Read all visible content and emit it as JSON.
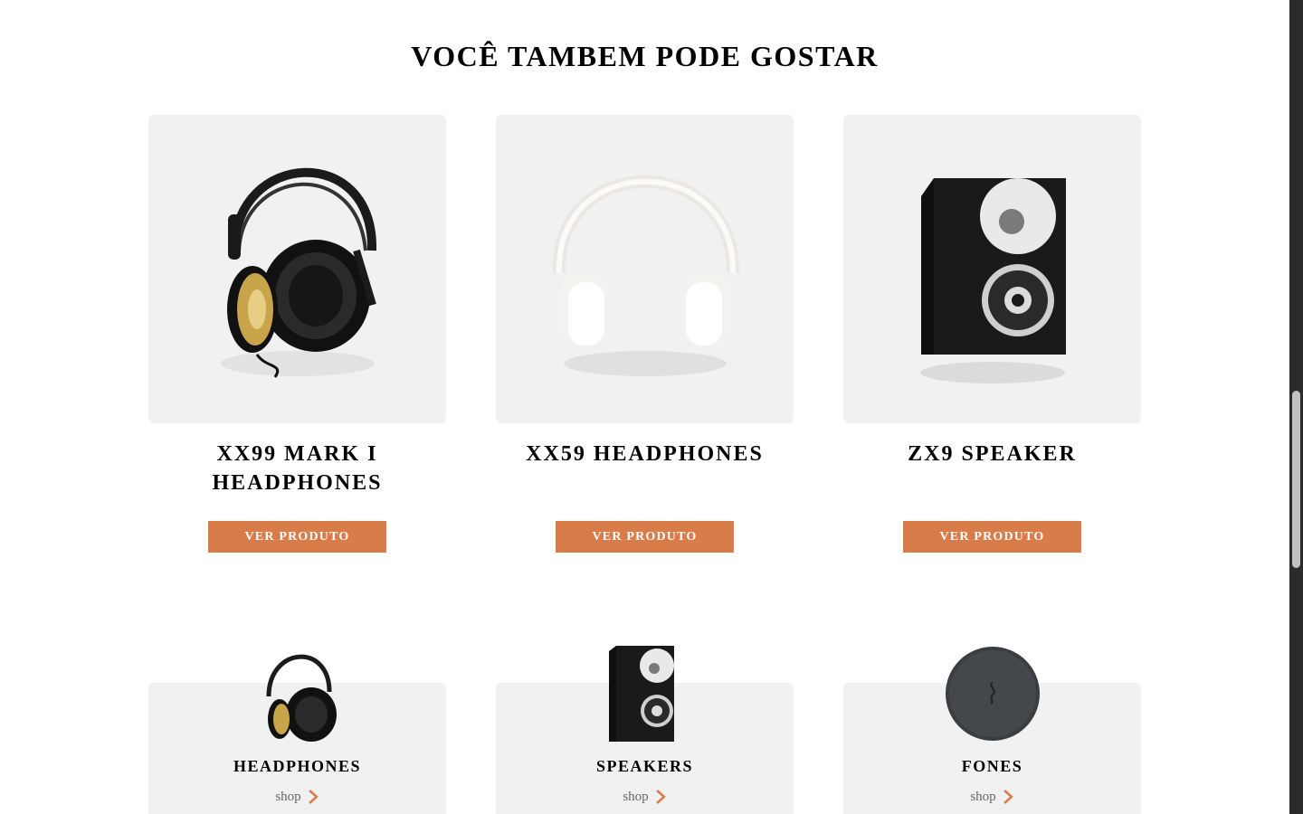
{
  "section": {
    "title": "VOCÊ TAMBEM PODE GOSTAR"
  },
  "products": [
    {
      "name": "XX99 MARK I HEADPHONES",
      "button": "VER PRODUTO",
      "image_icon": "black-gold-headphones-image"
    },
    {
      "name": "XX59 HEADPHONES",
      "button": "VER PRODUTO",
      "image_icon": "white-headphones-image"
    },
    {
      "name": "ZX9 SPEAKER",
      "button": "VER PRODUTO",
      "image_icon": "speaker-image"
    }
  ],
  "categories": [
    {
      "name": "HEADPHONES",
      "link": "shop",
      "image_icon": "headphones-thumbnail"
    },
    {
      "name": "SPEAKERS",
      "link": "shop",
      "image_icon": "speaker-thumbnail"
    },
    {
      "name": "FONES",
      "link": "shop",
      "image_icon": "earphones-case-thumbnail"
    }
  ],
  "colors": {
    "accent": "#d87d4a",
    "card_bg": "#f1f1f1",
    "text": "#000000"
  }
}
